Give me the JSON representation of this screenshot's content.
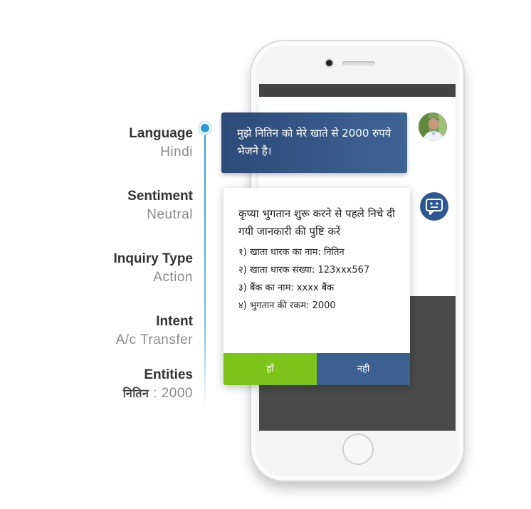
{
  "annotations": [
    {
      "label": "Language",
      "value": "Hindi"
    },
    {
      "label": "Sentiment",
      "value": "Neutral"
    },
    {
      "label": "Inquiry Type",
      "value": "Action"
    },
    {
      "label": "Intent",
      "value": "A/c Transfer"
    },
    {
      "label": "Entities",
      "value_entity": "नितिन",
      "value_rest": " : 2000"
    }
  ],
  "chat": {
    "user_message": "मुझे नितिन को मेरे खाते से 2000 रुपये भेजने है।",
    "bot_message": "कृप्या भुगतान शुरू करने से पहले निचे दी गयी जानकारी की पुष्टि करें",
    "details": [
      "१) खाता धारक का नाम: नितिन",
      "२) खाता धारक संख्या: 123xxx567",
      "३) बैंक का नाम: xxxx बैंक",
      "४) भुगतान की रकम: 2000"
    ],
    "yes_label": "हाँ",
    "no_label": "नही"
  },
  "colors": {
    "accent_line": "#2a9bd8",
    "user_bubble": "#34507f",
    "yes_button": "#7dc41a",
    "no_button": "#3c6090",
    "bot_icon_bg": "#2d5791"
  },
  "icons": {
    "user_avatar": "user-avatar-photo",
    "bot": "chatbot-face-icon"
  }
}
